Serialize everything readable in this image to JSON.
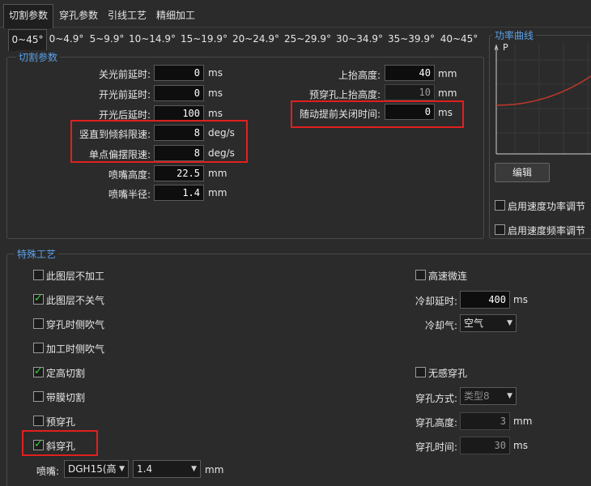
{
  "top_tabs": [
    {
      "label": "切割参数"
    },
    {
      "label": "穿孔参数"
    },
    {
      "label": "引线工艺"
    },
    {
      "label": "精细加工"
    }
  ],
  "sub_tabs": [
    {
      "label": "0~45°"
    },
    {
      "label": "0~4.9°"
    },
    {
      "label": "5~9.9°"
    },
    {
      "label": "10~14.9°"
    },
    {
      "label": "15~19.9°"
    },
    {
      "label": "20~24.9°"
    },
    {
      "label": "25~29.9°"
    },
    {
      "label": "30~34.9°"
    },
    {
      "label": "35~39.9°"
    },
    {
      "label": "40~45°"
    }
  ],
  "cut_params": {
    "title": "切割参数",
    "rows_left": [
      {
        "label": "关光前延时:",
        "value": "0",
        "unit": "ms"
      },
      {
        "label": "开光前延时:",
        "value": "0",
        "unit": "ms"
      },
      {
        "label": "开光后延时:",
        "value": "100",
        "unit": "ms"
      },
      {
        "label": "竖直到倾斜限速:",
        "value": "8",
        "unit": "deg/s"
      },
      {
        "label": "单点偏摆限速:",
        "value": "8",
        "unit": "deg/s"
      },
      {
        "label": "喷嘴高度:",
        "value": "22.5",
        "unit": "mm"
      },
      {
        "label": "喷嘴半径:",
        "value": "1.4",
        "unit": "mm"
      }
    ],
    "rows_right": [
      {
        "label": "上抬高度:",
        "value": "40",
        "unit": "mm"
      },
      {
        "label": "预穿孔上抬高度:",
        "value": "10",
        "unit": "mm"
      },
      {
        "label": "随动提前关闭时间:",
        "value": "0",
        "unit": "ms"
      }
    ]
  },
  "power_curve": {
    "title": "功率曲线",
    "axis_label": "P",
    "curve_color": "#c0392b",
    "edit_button": "编辑",
    "options": [
      {
        "label": "启用速度功率调节",
        "checked": false
      },
      {
        "label": "启用速度频率调节",
        "checked": false
      }
    ]
  },
  "special": {
    "title": "特殊工艺",
    "left_options": [
      {
        "label": "此图层不加工",
        "checked": false
      },
      {
        "label": "此图层不关气",
        "checked": true
      },
      {
        "label": "穿孔时侧吹气",
        "checked": false
      },
      {
        "label": "加工时侧吹气",
        "checked": false
      },
      {
        "label": "定高切割",
        "checked": true
      },
      {
        "label": "带膜切割",
        "checked": false
      },
      {
        "label": "预穿孔",
        "checked": false
      },
      {
        "label": "斜穿孔",
        "checked": true
      }
    ],
    "high_speed_link": {
      "label": "高速微连",
      "checked": false
    },
    "cooling_delay": {
      "label": "冷却延时:",
      "value": "400",
      "unit": "ms"
    },
    "cooling_gas": {
      "label": "冷却气:",
      "value": "空气"
    },
    "no_sense_pierce": {
      "label": "无感穿孔",
      "checked": false
    },
    "pierce_mode": {
      "label": "穿孔方式:",
      "value": "类型8"
    },
    "pierce_height": {
      "label": "穿孔高度:",
      "value": "3",
      "unit": "mm"
    },
    "pierce_time": {
      "label": "穿孔时间:",
      "value": "30",
      "unit": "ms"
    },
    "nozzle": {
      "label": "喷嘴:",
      "type": "DGH15(高",
      "size": "1.4",
      "unit": "mm"
    }
  },
  "colors": {
    "accent_title": "#5aa0e8",
    "highlight_box": "#e0201e",
    "check_green": "#3ad13a"
  }
}
